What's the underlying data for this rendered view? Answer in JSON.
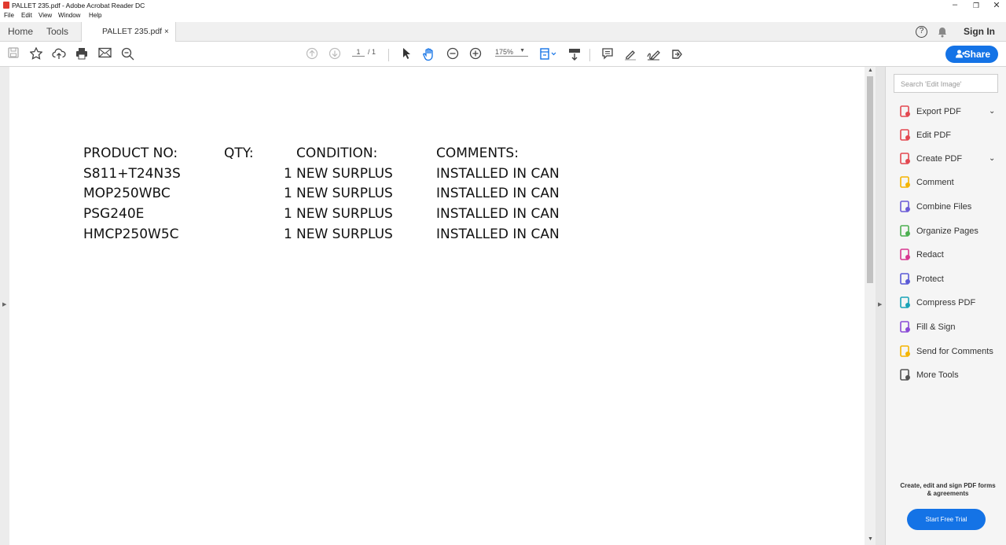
{
  "window": {
    "title": "PALLET 235.pdf - Adobe Acrobat Reader DC",
    "min": "–",
    "max": "❐",
    "close": "✕"
  },
  "menu": [
    "File",
    "Edit",
    "View",
    "Window",
    "Help"
  ],
  "tabs": {
    "home": "Home",
    "tools": "Tools",
    "doc": "PALLET 235.pdf",
    "doc_close": "×",
    "help": "?",
    "signin": "Sign In"
  },
  "toolbar": {
    "page_current": "1",
    "page_total": "/ 1",
    "zoom": "175%",
    "share": "Share"
  },
  "document": {
    "headers": [
      "PRODUCT NO:",
      "QTY:",
      "CONDITION:",
      "COMMENTS:"
    ],
    "rows": [
      {
        "product": "S811+T24N3S",
        "qty": "1",
        "condition": "NEW SURPLUS",
        "comment": "INSTALLED IN CAN"
      },
      {
        "product": "MOP250WBC",
        "qty": "1",
        "condition": "NEW SURPLUS",
        "comment": "INSTALLED IN CAN"
      },
      {
        "product": "PSG240E",
        "qty": "1",
        "condition": "NEW SURPLUS",
        "comment": "INSTALLED IN CAN"
      },
      {
        "product": "HMCP250W5C",
        "qty": "1",
        "condition": "NEW SURPLUS",
        "comment": "INSTALLED IN CAN"
      }
    ]
  },
  "panel": {
    "search_placeholder": "Search 'Edit Image'",
    "tools": [
      {
        "label": "Export PDF",
        "icon": "export-pdf-icon",
        "color": "#e34850",
        "chev": "⌄"
      },
      {
        "label": "Edit PDF",
        "icon": "edit-pdf-icon",
        "color": "#e34850",
        "chev": ""
      },
      {
        "label": "Create PDF",
        "icon": "create-pdf-icon",
        "color": "#e34850",
        "chev": "⌄"
      },
      {
        "label": "Comment",
        "icon": "comment-icon",
        "color": "#f5b400",
        "chev": ""
      },
      {
        "label": "Combine Files",
        "icon": "combine-files-icon",
        "color": "#6b5bd6",
        "chev": ""
      },
      {
        "label": "Organize Pages",
        "icon": "organize-pages-icon",
        "color": "#4caf50",
        "chev": ""
      },
      {
        "label": "Redact",
        "icon": "redact-icon",
        "color": "#d83790",
        "chev": ""
      },
      {
        "label": "Protect",
        "icon": "protect-icon",
        "color": "#5a5ad6",
        "chev": ""
      },
      {
        "label": "Compress PDF",
        "icon": "compress-pdf-icon",
        "color": "#1aa3b8",
        "chev": ""
      },
      {
        "label": "Fill & Sign",
        "icon": "fill-sign-icon",
        "color": "#8a4bd6",
        "chev": ""
      },
      {
        "label": "Send for Comments",
        "icon": "send-comments-icon",
        "color": "#f5b400",
        "chev": ""
      },
      {
        "label": "More Tools",
        "icon": "more-tools-icon",
        "color": "#555555",
        "chev": ""
      }
    ],
    "promo": "Create, edit and sign PDF forms & agreements",
    "trial": "Start Free Trial"
  }
}
